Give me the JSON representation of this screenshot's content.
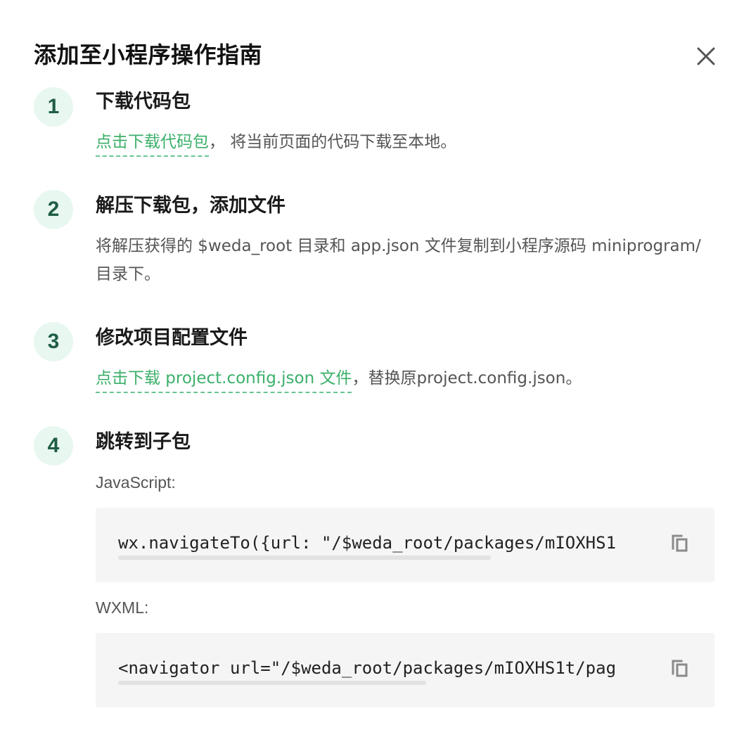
{
  "dialog": {
    "title": "添加至小程序操作指南",
    "close_icon": "close-icon"
  },
  "steps": [
    {
      "number": "1",
      "title": "下载代码包",
      "link": "点击下载代码包",
      "text": "， 将当前页面的代码下载至本地。"
    },
    {
      "number": "2",
      "title": "解压下载包，添加文件",
      "line1": "将解压获得的 $weda_root 目录和 app.json 文件复制到小程序源码 miniprogram/",
      "line2": "目录下。"
    },
    {
      "number": "3",
      "title": "修改项目配置文件",
      "link": "点击下载 project.config.json 文件",
      "text": "，替换原project.config.json。"
    },
    {
      "number": "4",
      "title": "跳转到子包",
      "js_label": "JavaScript:",
      "js_code": "wx.navigateTo({url: \"/$weda_root/packages/mIOXHS1",
      "wxml_label": "WXML:",
      "wxml_code": "<navigator url=\"/$weda_root/packages/mIOXHS1t/pag",
      "copy_icon": "copy-icon"
    }
  ],
  "colors": {
    "accent_green": "#3bb06a",
    "number_bg": "#e8f7f0",
    "number_fg": "#1f5e44",
    "code_bg": "#f5f5f5"
  }
}
